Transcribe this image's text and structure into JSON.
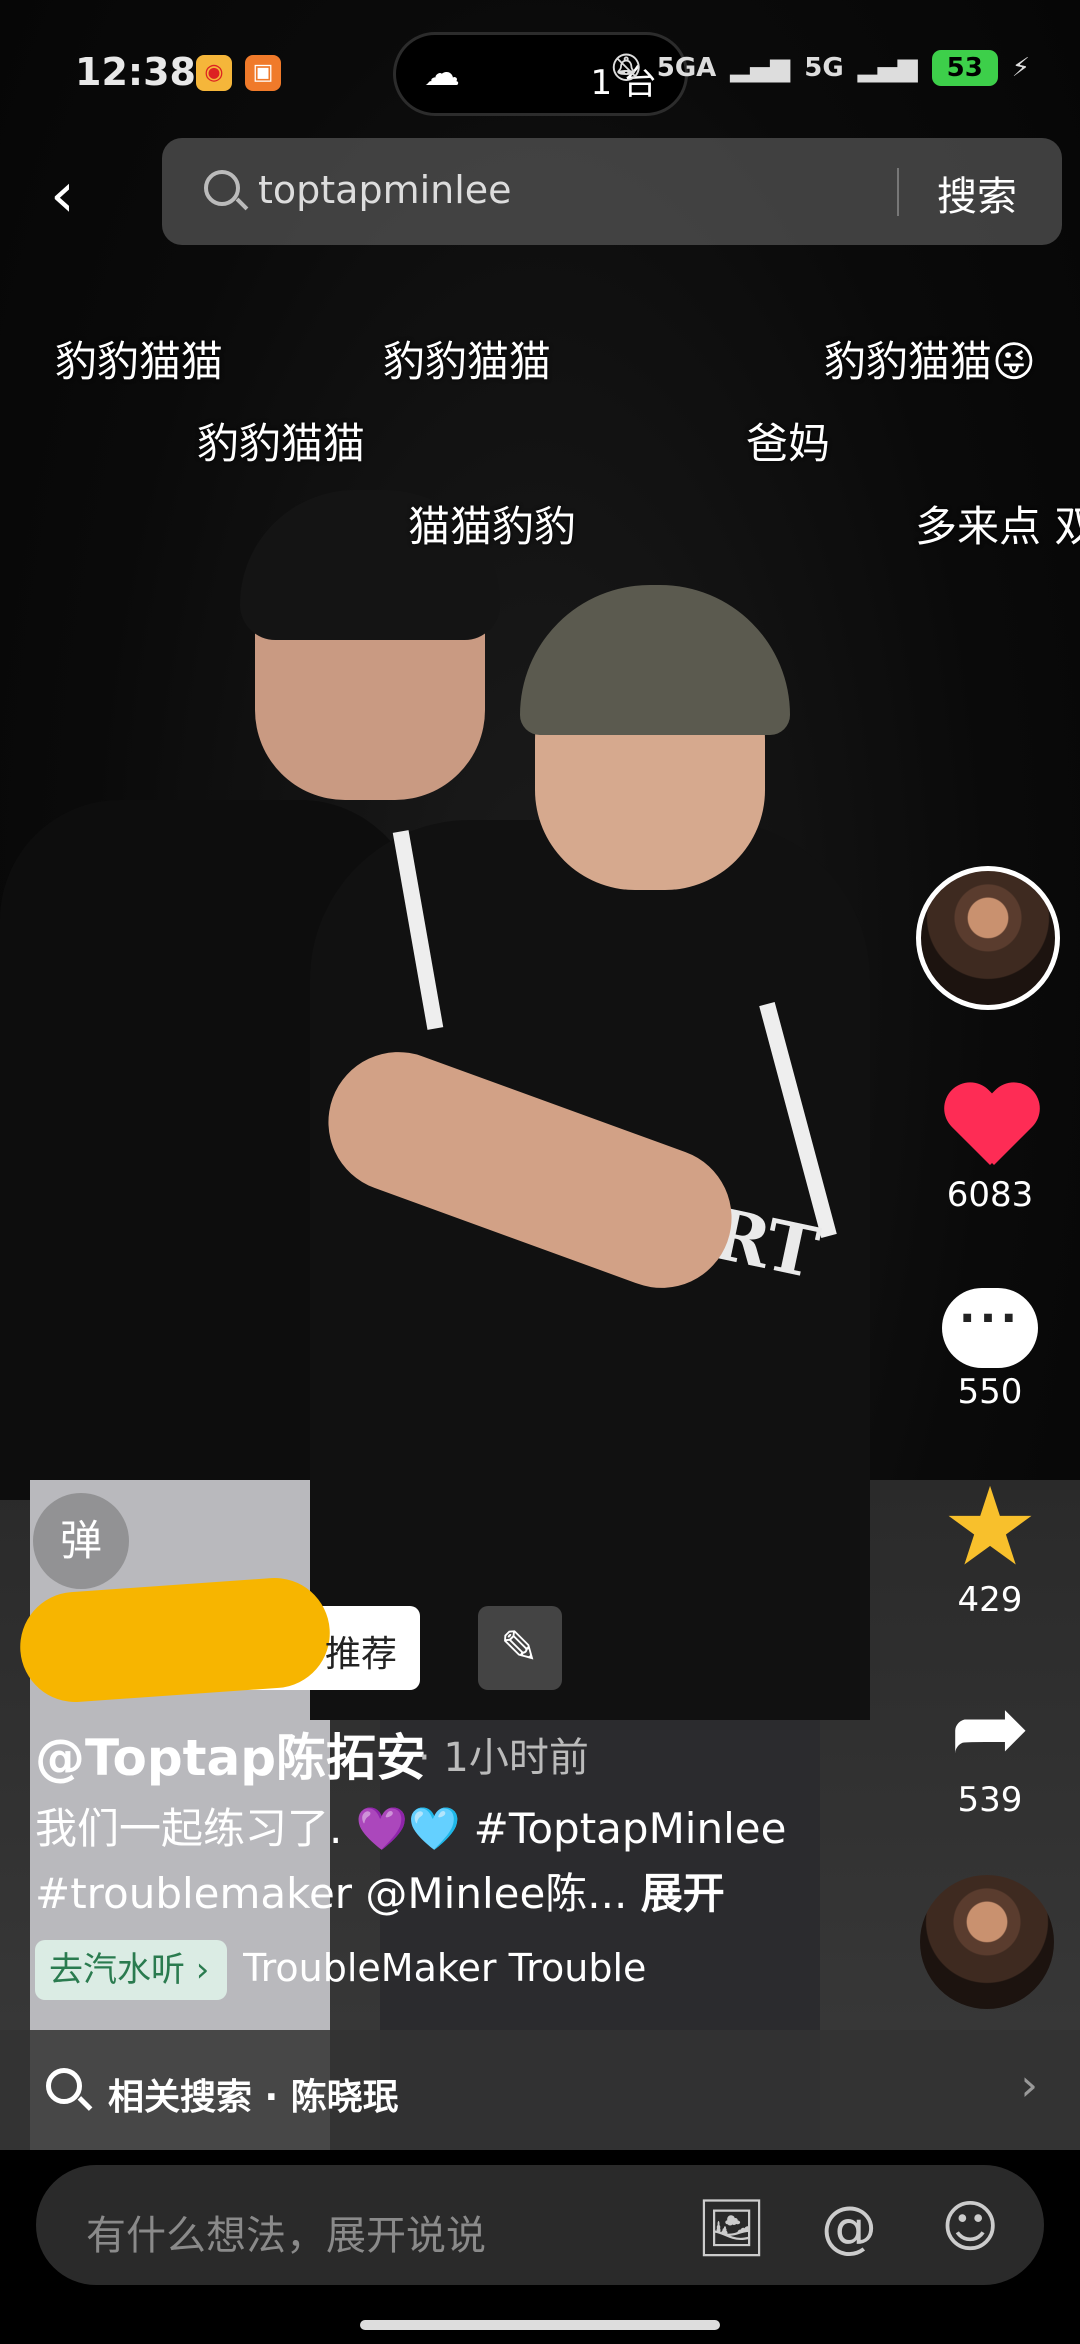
{
  "status_bar": {
    "time": "12:38",
    "island_text": "1 台",
    "signal1": "5GA",
    "signal2": "5G",
    "battery": "53"
  },
  "search": {
    "query": "toptapminlee",
    "button": "搜索"
  },
  "danmaku": [
    "豹豹猫猫",
    "豹豹猫猫",
    "豹豹猫猫😜",
    "豹豹猫猫",
    "爸妈",
    "猫猫豹豹",
    "多来点 双"
  ],
  "actions": {
    "likes": "6083",
    "comments": "550",
    "favorites": "429",
    "shares": "539"
  },
  "post": {
    "danmu_toggle": "弹",
    "tag_label": "推荐",
    "author": "@Toptap陈拓安",
    "time": "· 1小时前",
    "caption_line1": "我们一起练习了. 💜🩵 #ToptapMinlee",
    "caption_line2": "#troublemaker @Minlee陈...",
    "expand": "展开",
    "music_chip": "去汽水听 ›",
    "music_track": "TroubleMaker    Trouble"
  },
  "related": {
    "text": "相关搜索 · 陈晓珉"
  },
  "comment": {
    "placeholder": "有什么想法，展开说说"
  }
}
